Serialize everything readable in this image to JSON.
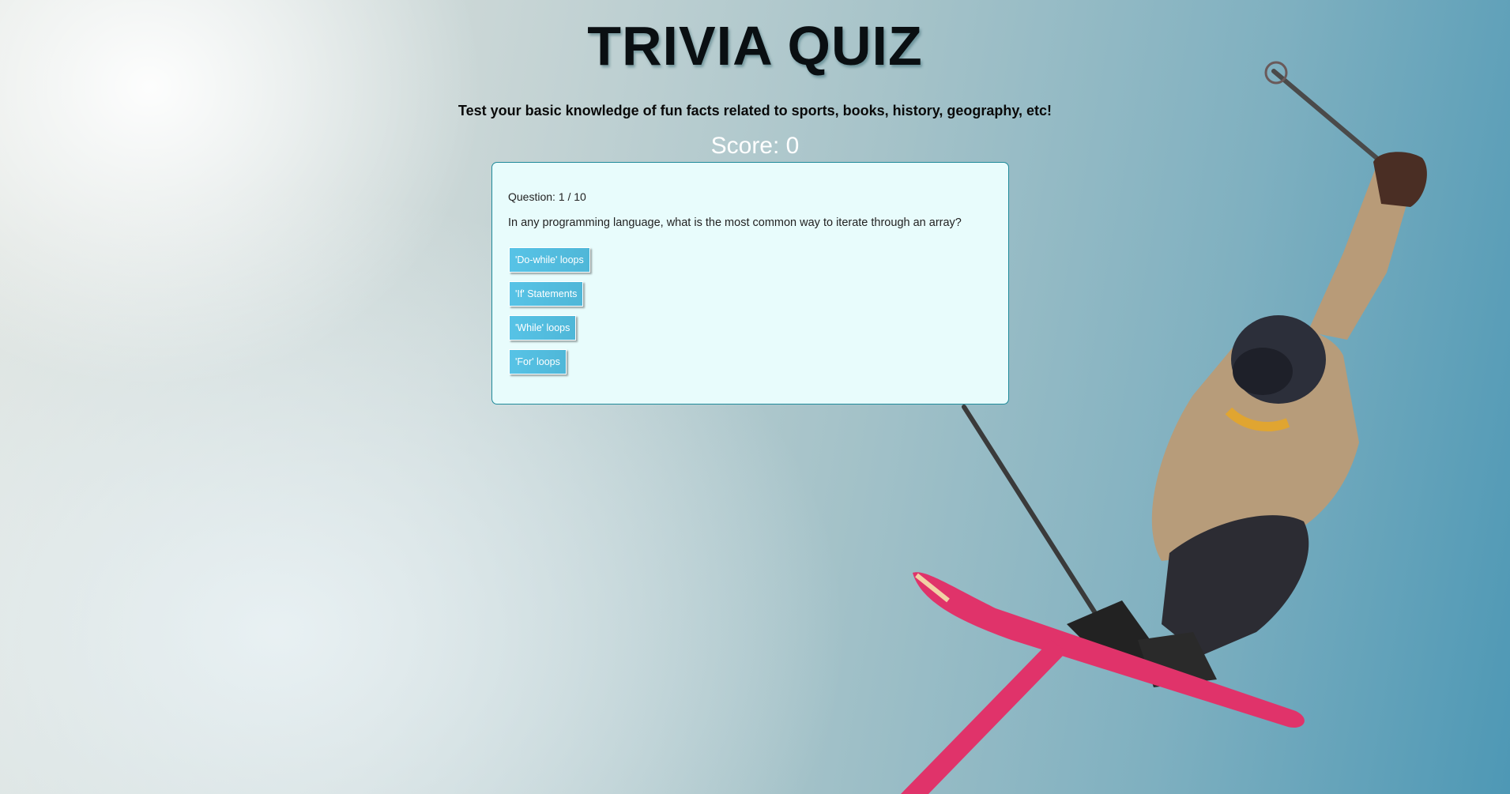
{
  "header": {
    "title": "TRIVIA QUIZ",
    "subtitle": "Test your basic knowledge of fun facts related to sports, books, history, geography, etc!"
  },
  "score": {
    "label": "Score: 0"
  },
  "quiz": {
    "question_number": "Question: 1 / 10",
    "question_text": "In any programming language, what is the most common way to iterate through an array?",
    "answers": [
      {
        "label": "'Do-while' loops"
      },
      {
        "label": "'If' Statements"
      },
      {
        "label": "'While' loops"
      },
      {
        "label": "'For' loops"
      }
    ]
  },
  "colors": {
    "answer_button": "#57c3e6",
    "card_background": "#e8fcfc",
    "card_border": "#1f8a9a"
  }
}
